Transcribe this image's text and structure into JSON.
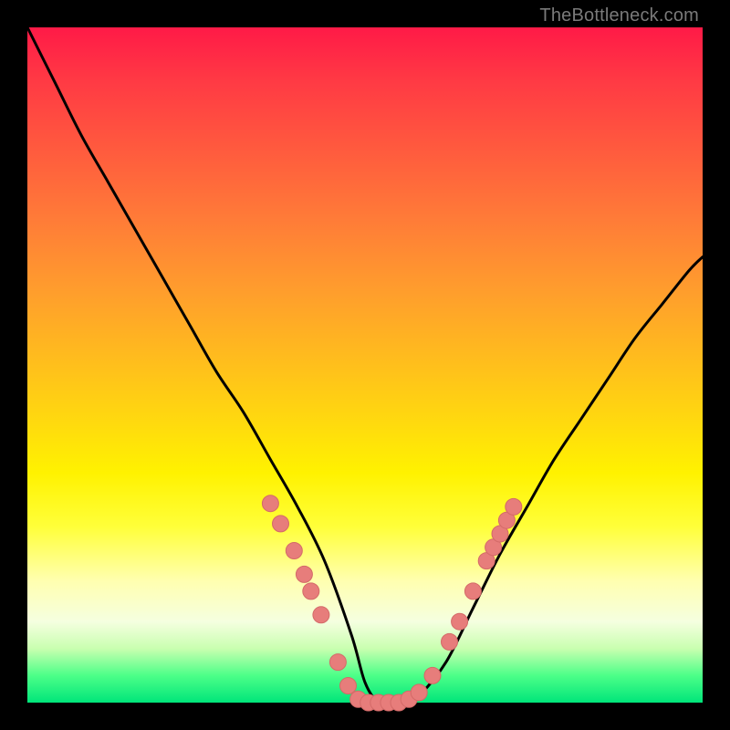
{
  "watermark": "TheBottleneck.com",
  "colors": {
    "frame": "#000000",
    "curve": "#000000",
    "marker_fill": "#e77d7b",
    "marker_stroke": "#d46a68"
  },
  "chart_data": {
    "type": "line",
    "title": "",
    "xlabel": "",
    "ylabel": "",
    "xlim": [
      0,
      100
    ],
    "ylim": [
      0,
      100
    ],
    "grid": false,
    "legend": false,
    "annotations": [],
    "series": [
      {
        "name": "bottleneck-curve",
        "x": [
          0,
          4,
          8,
          12,
          16,
          20,
          24,
          28,
          32,
          36,
          40,
          44,
          48,
          50,
          52,
          54,
          56,
          58,
          62,
          66,
          70,
          74,
          78,
          82,
          86,
          90,
          94,
          98,
          100
        ],
        "y": [
          100,
          92,
          84,
          77,
          70,
          63,
          56,
          49,
          43,
          36,
          29,
          21,
          10,
          3,
          0,
          0,
          0,
          1,
          6,
          14,
          22,
          29,
          36,
          42,
          48,
          54,
          59,
          64,
          66
        ]
      }
    ],
    "markers": [
      {
        "x": 36.0,
        "y": 29.5
      },
      {
        "x": 37.5,
        "y": 26.5
      },
      {
        "x": 39.5,
        "y": 22.5
      },
      {
        "x": 41.0,
        "y": 19.0
      },
      {
        "x": 42.0,
        "y": 16.5
      },
      {
        "x": 43.5,
        "y": 13.0
      },
      {
        "x": 46.0,
        "y": 6.0
      },
      {
        "x": 47.5,
        "y": 2.5
      },
      {
        "x": 49.0,
        "y": 0.5
      },
      {
        "x": 50.5,
        "y": 0.0
      },
      {
        "x": 52.0,
        "y": 0.0
      },
      {
        "x": 53.5,
        "y": 0.0
      },
      {
        "x": 55.0,
        "y": 0.0
      },
      {
        "x": 56.5,
        "y": 0.5
      },
      {
        "x": 58.0,
        "y": 1.5
      },
      {
        "x": 60.0,
        "y": 4.0
      },
      {
        "x": 62.5,
        "y": 9.0
      },
      {
        "x": 64.0,
        "y": 12.0
      },
      {
        "x": 66.0,
        "y": 16.5
      },
      {
        "x": 68.0,
        "y": 21.0
      },
      {
        "x": 69.0,
        "y": 23.0
      },
      {
        "x": 70.0,
        "y": 25.0
      },
      {
        "x": 71.0,
        "y": 27.0
      },
      {
        "x": 72.0,
        "y": 29.0
      }
    ]
  }
}
